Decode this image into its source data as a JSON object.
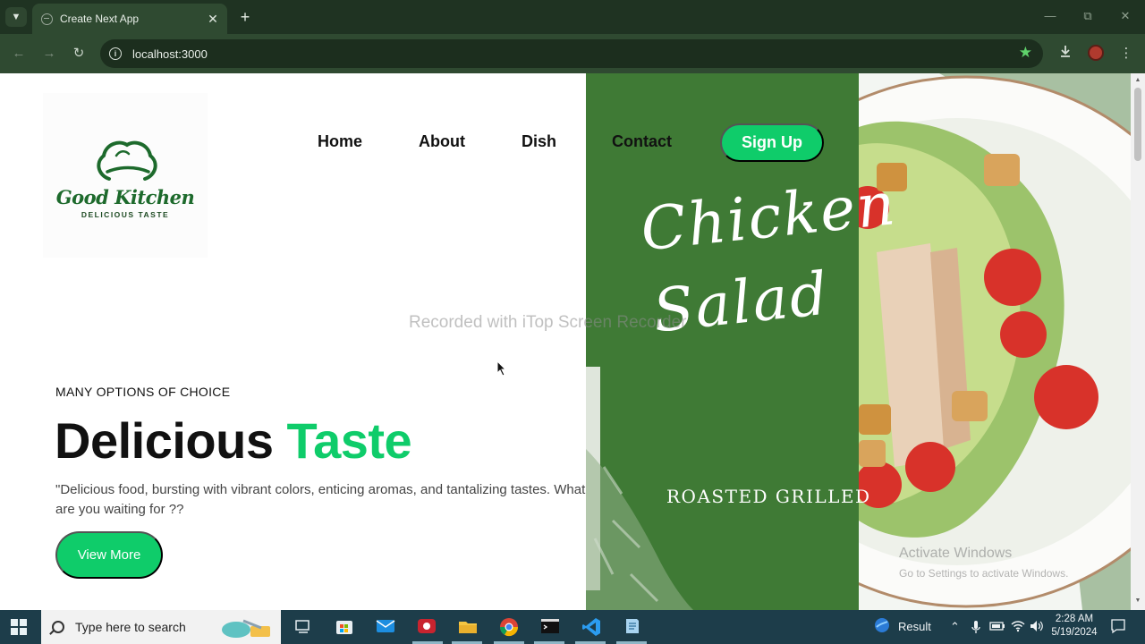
{
  "browser": {
    "tab_title": "Create Next App",
    "url": "localhost:3000"
  },
  "site": {
    "logo": {
      "name": "Good Kitchen",
      "tagline": "DELICIOUS TASTE"
    },
    "nav": [
      {
        "label": "Home"
      },
      {
        "label": "About"
      },
      {
        "label": "Dish"
      },
      {
        "label": "Contact"
      }
    ],
    "signup_label": "Sign Up",
    "hero": {
      "eyebrow": "MANY OPTIONS OF CHOICE",
      "headline_main": "Delicious",
      "headline_accent": "Taste",
      "description": "\"Delicious food, bursting with vibrant colors, enticing aromas, and tantalizing tastes. What are you waiting for ??",
      "cta_label": "View More"
    },
    "banner": {
      "title_line1": "Chicken",
      "title_line2": "Salad",
      "subtitle": "ROASTED GRILLED"
    },
    "colors": {
      "accent": "#0fcc6a",
      "panel_green": "#3f7a35",
      "brand_green": "#1d6a2c"
    }
  },
  "overlays": {
    "recorder_watermark": "Recorded with iTop Screen Recorder",
    "activate_title": "Activate Windows",
    "activate_sub": "Go to Settings to activate Windows."
  },
  "taskbar": {
    "search_placeholder": "Type here to search",
    "weather_label": "Result",
    "time": "2:28 AM",
    "date": "5/19/2024"
  }
}
